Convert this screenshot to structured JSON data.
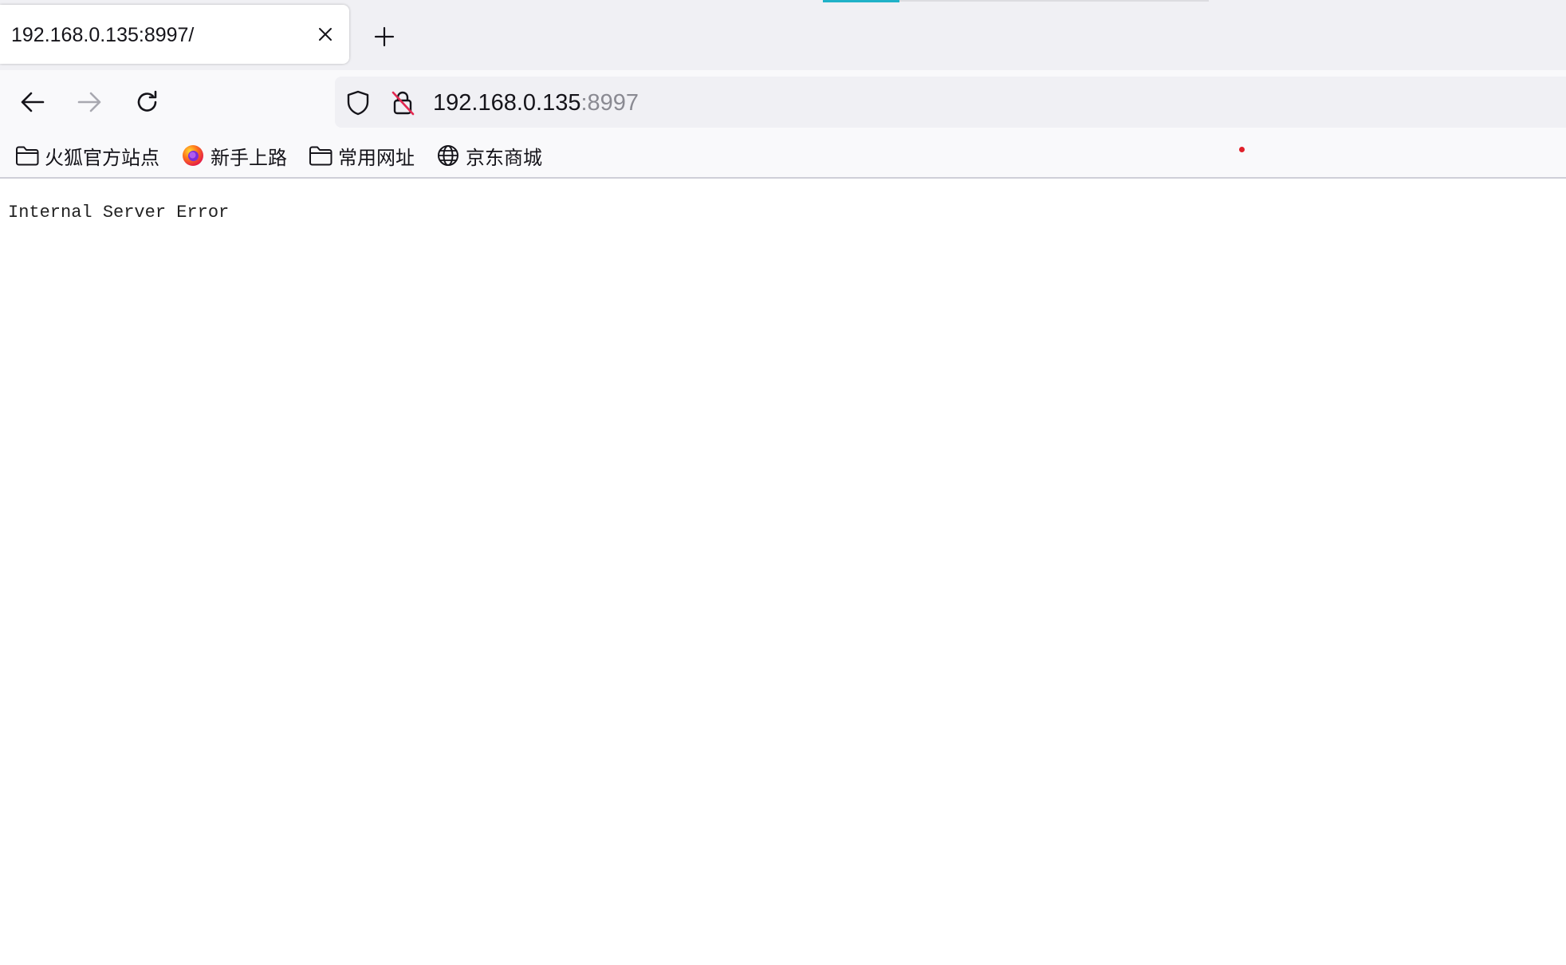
{
  "tab": {
    "title": "192.168.0.135:8997/"
  },
  "navbar": {
    "url_host": "192.168.0.135",
    "url_port": ":8997"
  },
  "bookmarks": {
    "items": [
      {
        "label": "火狐官方站点",
        "icon": "folder-icon"
      },
      {
        "label": "新手上路",
        "icon": "firefox-logo-icon"
      },
      {
        "label": "常用网址",
        "icon": "folder-icon"
      },
      {
        "label": "京东商城",
        "icon": "globe-icon"
      }
    ]
  },
  "page": {
    "body_text": "Internal Server Error"
  },
  "colors": {
    "accent": "#20b2c8",
    "tabstrip_bg": "#f0f0f4",
    "toolbar_bg": "#f9f9fb",
    "insecure_slash": "#e22850"
  }
}
